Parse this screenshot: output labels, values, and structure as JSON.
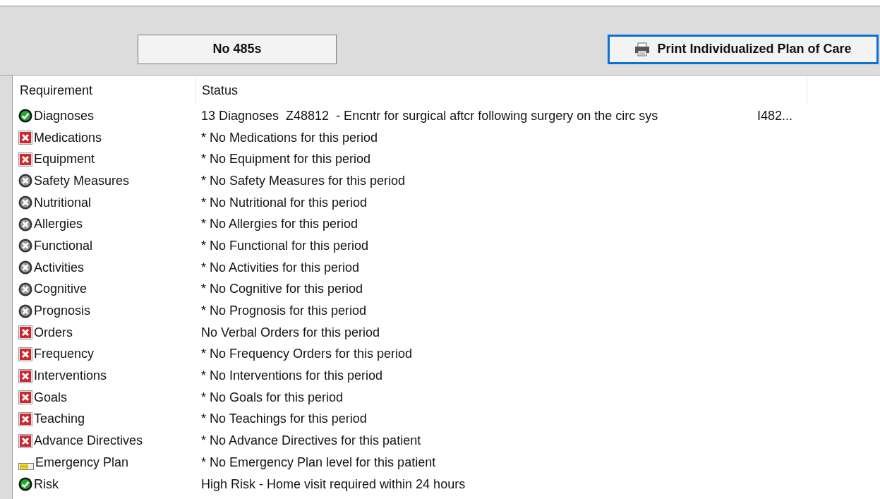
{
  "buttons": [
    {
      "label": "No 485s",
      "focused": false
    },
    {
      "label": "Print Individualized Plan of Care",
      "focused": true
    }
  ],
  "table": {
    "columns": [
      "Requirement",
      "Status"
    ],
    "rows": [
      {
        "requirement": "Diagnoses",
        "kind": "complete",
        "status": "13 Diagnoses  Z48812  - Encntr for surgical aftcr following surgery on the circ sys",
        "column_3": "I482..."
      },
      {
        "requirement": "Medications",
        "kind": "missing",
        "status": "* No Medications for this period"
      },
      {
        "requirement": "Equipment",
        "kind": "missing",
        "status": "* No Equipment for this period"
      },
      {
        "requirement": "Safety Measures",
        "kind": "not-applicable",
        "status": "* No Safety Measures for this period"
      },
      {
        "requirement": "Nutritional",
        "kind": "not-applicable",
        "status": "* No Nutritional for this period"
      },
      {
        "requirement": "Allergies",
        "kind": "not-applicable",
        "status": "* No Allergies for this period"
      },
      {
        "requirement": "Functional",
        "kind": "not-applicable",
        "status": "* No Functional for this period"
      },
      {
        "requirement": "Activities",
        "kind": "not-applicable",
        "status": "* No Activities for this period"
      },
      {
        "requirement": "Cognitive",
        "kind": "not-applicable",
        "status": "* No Cognitive for this period"
      },
      {
        "requirement": "Prognosis",
        "kind": "not-applicable",
        "status": "* No Prognosis for this period"
      },
      {
        "requirement": "Orders",
        "kind": "missing",
        "status": "No Verbal Orders for this period"
      },
      {
        "requirement": "Frequency",
        "kind": "missing",
        "status": "* No Frequency Orders for this period"
      },
      {
        "requirement": "Interventions",
        "kind": "missing",
        "status": "* No Interventions for this period"
      },
      {
        "requirement": "Goals",
        "kind": "missing",
        "status": "* No Goals for this period"
      },
      {
        "requirement": "Teaching",
        "kind": "missing",
        "status": "* No Teachings for this period"
      },
      {
        "requirement": "Advance Directives",
        "kind": "missing",
        "status": "* No Advance Directives for this patient"
      },
      {
        "requirement": "Emergency Plan",
        "kind": "partial",
        "status": "* No Emergency Plan level for this patient"
      },
      {
        "requirement": "Risk",
        "kind": "complete",
        "status": "High Risk - Home visit required within 24 hours"
      }
    ]
  }
}
